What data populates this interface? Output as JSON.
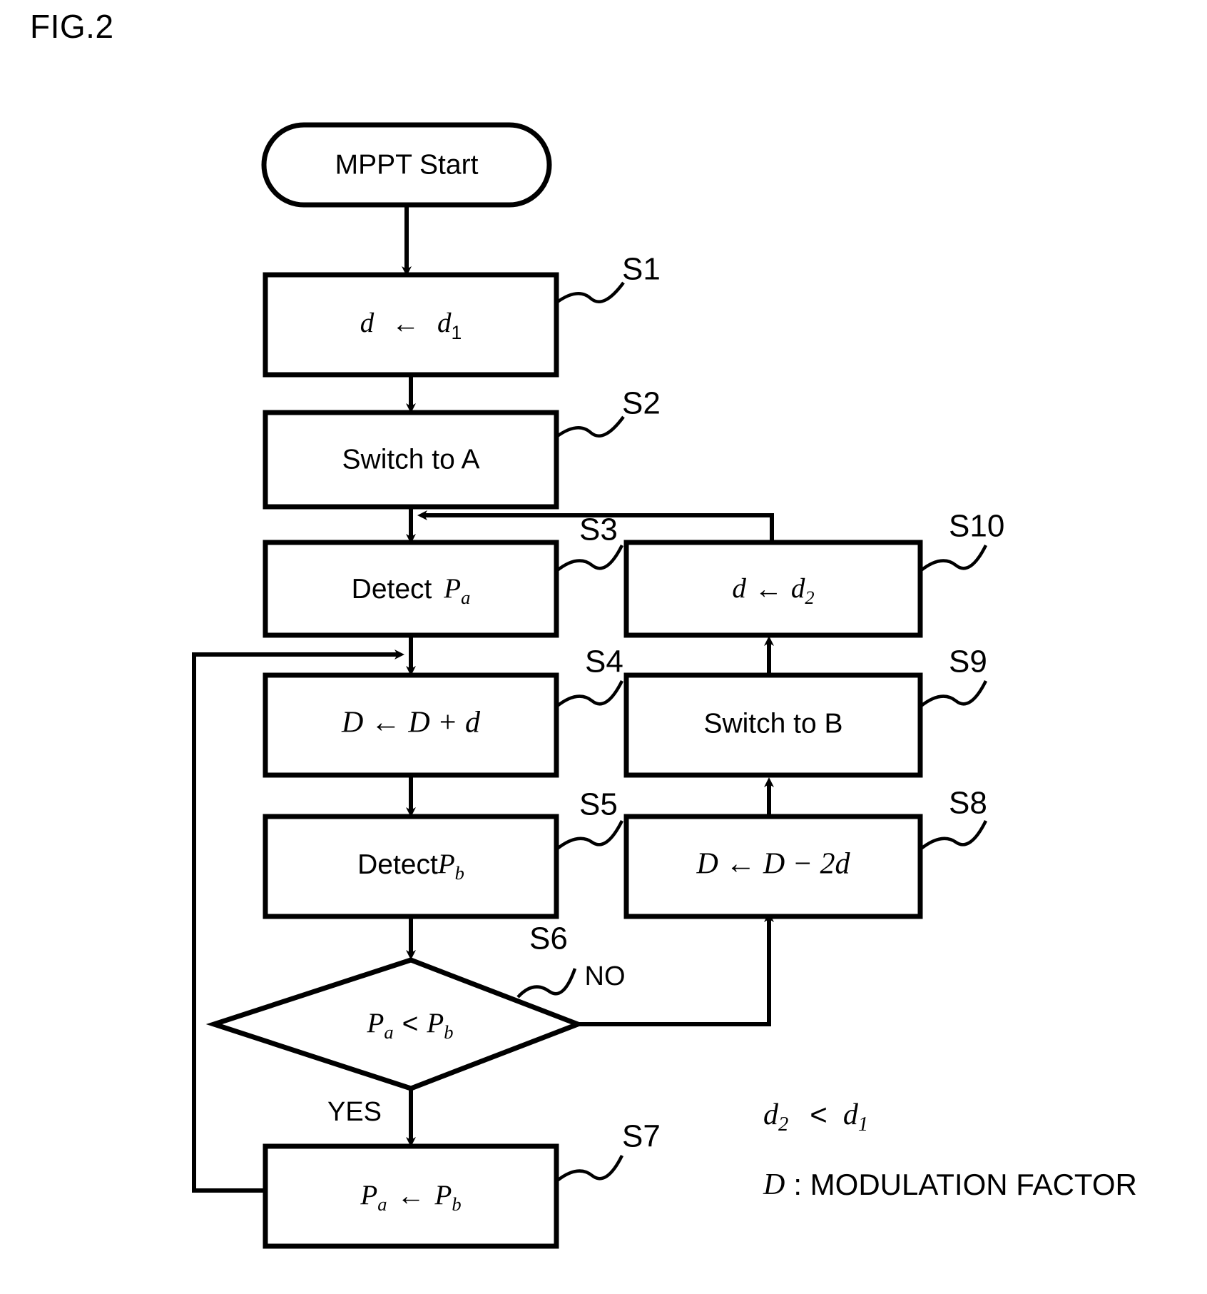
{
  "figure": {
    "title": "FIG.2",
    "type": "flowchart",
    "description": "MPPT control flowchart"
  },
  "nodes": {
    "start": {
      "id": "",
      "label": "MPPT Start",
      "shape": "stadium"
    },
    "s1": {
      "id": "S1",
      "label": "d ← d₁",
      "text_main": "d",
      "text_arrow": "←",
      "text_operand": "d",
      "text_sub": "1",
      "shape": "process"
    },
    "s2": {
      "id": "S2",
      "label": "Switch to A",
      "shape": "process"
    },
    "s3": {
      "id": "S3",
      "label": "Detect Pₐ",
      "text_main": "Detect ",
      "text_operand": "P",
      "text_sub": "a",
      "shape": "process"
    },
    "s4": {
      "id": "S4",
      "label": "D ← D + d",
      "shape": "process"
    },
    "s5": {
      "id": "S5",
      "label": "DetectPʙ",
      "text_main": "Detect",
      "text_operand": "P",
      "text_sub": "b",
      "shape": "process"
    },
    "s6": {
      "id": "S6",
      "label": "Pₐ < Pʙ",
      "text_left": "P",
      "text_left_sub": "a",
      "text_op": "<",
      "text_right": "P",
      "text_right_sub": "b",
      "shape": "decision"
    },
    "s7": {
      "id": "S7",
      "label": "Pₐ ← Pʙ",
      "text_left": "P",
      "text_left_sub": "a",
      "text_arrow": "←",
      "text_right": "P",
      "text_right_sub": "b",
      "shape": "process"
    },
    "s8": {
      "id": "S8",
      "label": "D ← D − 2d",
      "shape": "process"
    },
    "s9": {
      "id": "S9",
      "label": "Switch to B",
      "shape": "process"
    },
    "s10": {
      "id": "S10",
      "label": "d ← d₂",
      "text_main": "d",
      "text_arrow": "←",
      "text_operand": "d",
      "text_sub": "2",
      "shape": "process"
    }
  },
  "branches": {
    "yes": "YES",
    "no": "NO"
  },
  "legend": {
    "line1_left": "d",
    "line1_left_sub": "2",
    "line1_op": "<",
    "line1_right": "d",
    "line1_right_sub": "1",
    "line2_symbol": "D",
    "line2_text": ": MODULATION FACTOR"
  },
  "colors": {
    "stroke": "#000000",
    "fill": "#ffffff",
    "background": "#ffffff"
  }
}
